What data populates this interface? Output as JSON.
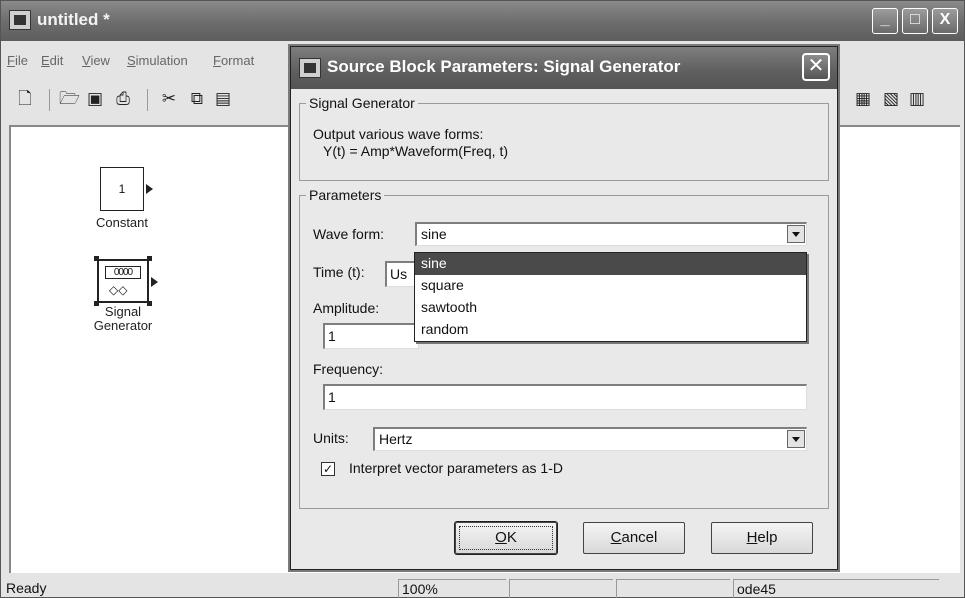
{
  "window": {
    "title": "untitled *",
    "controls": {
      "minimize": "_",
      "maximize": "□",
      "close": "X"
    }
  },
  "menu": [
    "File",
    "Edit",
    "View",
    "Simulation",
    "Format"
  ],
  "toolbar_icons": [
    "new-icon",
    "open-icon",
    "save-icon",
    "print-icon",
    "cut-icon",
    "copy-icon",
    "paste-icon",
    "library-icon",
    "model-explorer-icon",
    "properties-icon"
  ],
  "blocks": {
    "constant": {
      "value": "1",
      "label": "Constant"
    },
    "signal_generator": {
      "label_line1": "Signal",
      "label_line2": "Generator",
      "icon_wave": "0000",
      "icon_sym": "◇◇"
    }
  },
  "statusbar": {
    "status": "Ready",
    "zoom": "100%",
    "solver": "ode45"
  },
  "dialog": {
    "title": "Source Block Parameters: Signal Generator",
    "close": "✕",
    "block_group": {
      "legend": "Signal Generator",
      "desc_line1": "Output various wave forms:",
      "desc_line2": "Y(t) = Amp*Waveform(Freq, t)"
    },
    "params_group": {
      "legend": "Parameters"
    },
    "wave_form": {
      "label": "Wave form:",
      "value": "sine"
    },
    "time": {
      "label": "Time (t):",
      "value": "Us"
    },
    "amplitude": {
      "label": "Amplitude:",
      "value": "1"
    },
    "frequency": {
      "label": "Frequency:",
      "value": "1"
    },
    "units": {
      "label": "Units:",
      "value": "Hertz"
    },
    "interpret_vector": {
      "label": "Interpret vector parameters as 1-D",
      "checked": true,
      "mark": "✓"
    },
    "dropdown_options": [
      "sine",
      "square",
      "sawtooth",
      "random"
    ],
    "dropdown_selected": "sine",
    "buttons": {
      "ok": "OK",
      "cancel": "Cancel",
      "help": "Help"
    }
  }
}
